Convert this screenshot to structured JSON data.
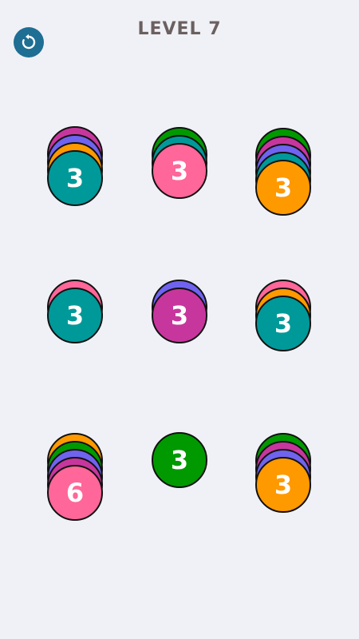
{
  "header": {
    "level_title": "LEVEL 7",
    "restart_icon": "restart-icon"
  },
  "palette": {
    "magenta": "#c7369d",
    "purple": "#6f63ef",
    "orange": "#ff9900",
    "teal": "#009999",
    "green": "#009900",
    "pink": "#ff6699",
    "button_blue": "#1f6e94"
  },
  "stacks": [
    {
      "id": "stack-1",
      "discs": [
        "magenta",
        "purple",
        "orange",
        "teal"
      ],
      "top_label": "3"
    },
    {
      "id": "stack-2",
      "discs": [
        "green",
        "teal",
        "pink"
      ],
      "top_label": "3"
    },
    {
      "id": "stack-3",
      "discs": [
        "green",
        "magenta",
        "purple",
        "teal",
        "orange"
      ],
      "top_label": "3"
    },
    {
      "id": "stack-4",
      "discs": [
        "pink",
        "teal"
      ],
      "top_label": "3"
    },
    {
      "id": "stack-5",
      "discs": [
        "purple",
        "magenta"
      ],
      "top_label": "3"
    },
    {
      "id": "stack-6",
      "discs": [
        "pink",
        "orange",
        "teal"
      ],
      "top_label": "3"
    },
    {
      "id": "stack-7",
      "discs": [
        "orange",
        "green",
        "purple",
        "magenta",
        "pink"
      ],
      "top_label": "6"
    },
    {
      "id": "stack-8",
      "discs": [
        "green"
      ],
      "top_label": "3"
    },
    {
      "id": "stack-9",
      "discs": [
        "green",
        "magenta",
        "purple",
        "orange"
      ],
      "top_label": "3"
    }
  ]
}
